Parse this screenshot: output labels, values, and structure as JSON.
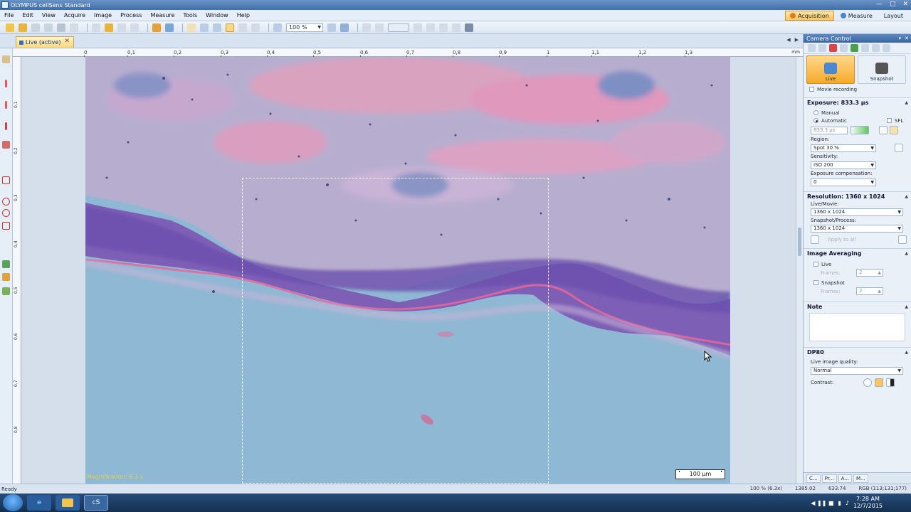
{
  "window": {
    "title": "OLYMPUS cellSens Standard",
    "controls": [
      "—",
      "▢",
      "✕"
    ]
  },
  "menu": [
    "File",
    "Edit",
    "View",
    "Acquire",
    "Image",
    "Process",
    "Measure",
    "Tools",
    "Window",
    "Help"
  ],
  "layout_tabs": {
    "acquisition": "Acquisition",
    "measure": "Measure",
    "layout": "Layout"
  },
  "toolbar": {
    "zoom_value": "100 %"
  },
  "document": {
    "tab_label": "Live (active)"
  },
  "ruler": {
    "h_ticks": [
      "0",
      "0,1",
      "0,2",
      "0,3",
      "0,4",
      "0,5",
      "0,6",
      "0,7",
      "0,8",
      "0,9",
      "1",
      "1,1",
      "1,2",
      "1,3"
    ],
    "v_ticks": [
      "0,1",
      "0,2",
      "0,3",
      "0,4",
      "0,5",
      "0,6",
      "0,7",
      "0,8"
    ],
    "unit": "mm"
  },
  "image": {
    "magnification": "Magnification: 6.3 x",
    "scale_bar": "100 µm"
  },
  "camera_panel": {
    "title": "Camera Control",
    "live_label": "Live",
    "snapshot_label": "Snapshot",
    "movie_recording": "Movie recording",
    "exposure_header": "Exposure: 833.3 µs",
    "manual": "Manual",
    "automatic": "Automatic",
    "sfl": "SFL",
    "exposure_value": "833.3 µs",
    "region_label": "Region:",
    "region_value": "Spot 30 %",
    "sensitivity_label": "Sensitivity:",
    "sensitivity_value": "ISO 200",
    "exp_comp_label": "Exposure compensation:",
    "exp_comp_value": "0",
    "resolution_header": "Resolution: 1360 x 1024",
    "live_movie_label": "Live/Movie:",
    "live_movie_value": "1360 x 1024",
    "snapshot_process_label": "Snapshot/Process:",
    "snapshot_process_value": "1360 x 1024",
    "apply_label": "Apply to all",
    "image_averaging_header": "Image Averaging",
    "avg_live": "Live",
    "avg_snapshot": "Snapshot",
    "frames_label": "Frames:",
    "frames_live": "2",
    "frames_snapshot": "2",
    "note_header": "Note",
    "dp80_header": "DP80",
    "live_quality_label": "Live image quality:",
    "live_quality_value": "Normal",
    "contrast_label": "Contrast:",
    "bottom_tabs": [
      "C...",
      "Pr...",
      "A...",
      "M..."
    ]
  },
  "status": {
    "left": "Ready",
    "zoom": "100 % (6.3x)",
    "coord_x": "1385.02",
    "coord_y": "633.74",
    "rgb": "RGB (113;131;177)"
  },
  "taskbar": {
    "time": "7:28 AM",
    "date": "12/7/2015",
    "cs_label": "cS"
  }
}
